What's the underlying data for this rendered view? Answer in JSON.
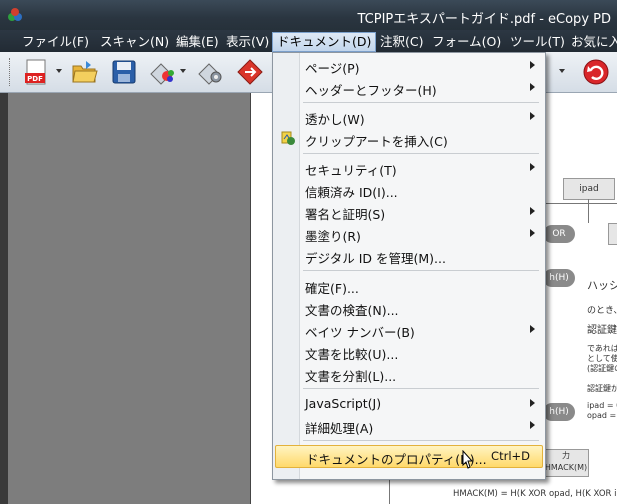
{
  "window": {
    "title": "TCPIPエキスパートガイド.pdf - eCopy PD"
  },
  "menubar": {
    "items": [
      {
        "label": "ファイル(F)"
      },
      {
        "label": "スキャン(N)"
      },
      {
        "label": "編集(E)"
      },
      {
        "label": "表示(V)"
      },
      {
        "label": "ドキュメント(D)"
      },
      {
        "label": "注釈(C)"
      },
      {
        "label": "フォーム(O)"
      },
      {
        "label": "ツール(T)"
      },
      {
        "label": "お気に入"
      }
    ]
  },
  "toolbar": {
    "buttons": [
      {
        "icon": "pdf-create-icon",
        "badge": "PDF"
      },
      {
        "icon": "open-folder-icon"
      },
      {
        "icon": "save-disk-icon"
      },
      {
        "icon": "color-palette-icon"
      },
      {
        "icon": "settings-gear-icon"
      },
      {
        "icon": "convert-red-icon"
      },
      {
        "icon": "undo-red-icon"
      }
    ]
  },
  "document_menu": {
    "items": [
      {
        "label": "ページ(P)",
        "submenu": true
      },
      {
        "label": "ヘッダーとフッター(H)",
        "submenu": true
      },
      {
        "label": "透かし(W)",
        "submenu": true
      },
      {
        "label": "クリップアートを挿入(C)",
        "icon": "clipart-icon"
      },
      {
        "label": "セキュリティ(T)",
        "submenu": true
      },
      {
        "label": "信頼済み ID(I)..."
      },
      {
        "label": "署名と証明(S)",
        "submenu": true
      },
      {
        "label": "墨塗り(R)",
        "submenu": true
      },
      {
        "label": "デジタル ID を管理(M)..."
      },
      {
        "label": "確定(F)..."
      },
      {
        "label": "文書の検査(N)..."
      },
      {
        "label": "ベイツ ナンバー(B)",
        "submenu": true
      },
      {
        "label": "文書を比較(U)..."
      },
      {
        "label": "文書を分割(L)..."
      },
      {
        "label": "JavaScript(J)",
        "submenu": true
      },
      {
        "label": "詳細処理(A)",
        "submenu": true
      },
      {
        "label": "ドキュメントのプロパティ(D)...",
        "shortcut": "Ctrl+D",
        "highlighted": true
      }
    ]
  },
  "document_page": {
    "box_ipad": "ipad",
    "pill_xor": "OR",
    "pill_hash1": "h(H)",
    "pill_hash2": "h(H)",
    "text_hash": "ハッシ",
    "text_notoki": "のとき、",
    "text_ninsho": "認証鍵の",
    "text_dearebe": "であれば認",
    "text_toshite": "として使用",
    "text_ninshokey": "(認証鍵の",
    "text_ninshokaga": "認証鍵が鍵",
    "text_ipad": "ipad = 0x3",
    "text_opad": "opad = 0x",
    "box_hmac_top": "力",
    "box_hmac": "HMACK(M)",
    "formula": "HMACK(M) = H(K XOR opad, H(K XOR ipad"
  },
  "colors": {
    "highlight": "#ffd96b",
    "titlebar": "#2a3540"
  }
}
